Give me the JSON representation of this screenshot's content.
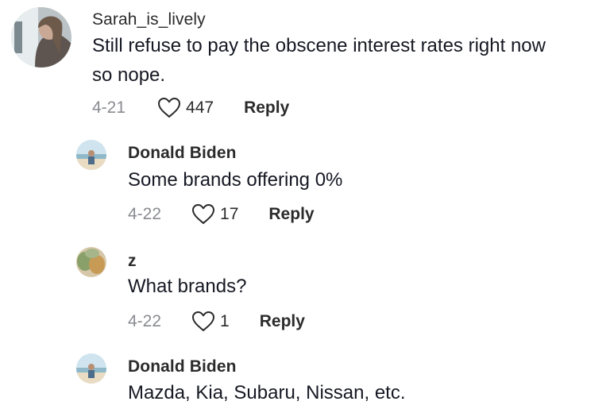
{
  "comments": [
    {
      "username": "Sarah_is_lively",
      "text_line1": "Still refuse to pay the obscene interest rates right now",
      "text_line2": "so nope.",
      "date": "4-21",
      "likes": "447",
      "reply_label": "Reply"
    },
    {
      "username": "Donald Biden",
      "text": "Some brands offering 0%",
      "date": "4-22",
      "likes": "17",
      "reply_label": "Reply"
    },
    {
      "username": "z",
      "text": "What brands?",
      "date": "4-22",
      "likes": "1",
      "reply_label": "Reply"
    },
    {
      "username": "Donald Biden",
      "text": "Mazda, Kia, Subaru, Nissan, etc."
    }
  ],
  "icons": {
    "like": "heart-outline-icon"
  },
  "colors": {
    "text": "#161823",
    "muted": "#8a8b91",
    "username": "#2b2b2b"
  }
}
